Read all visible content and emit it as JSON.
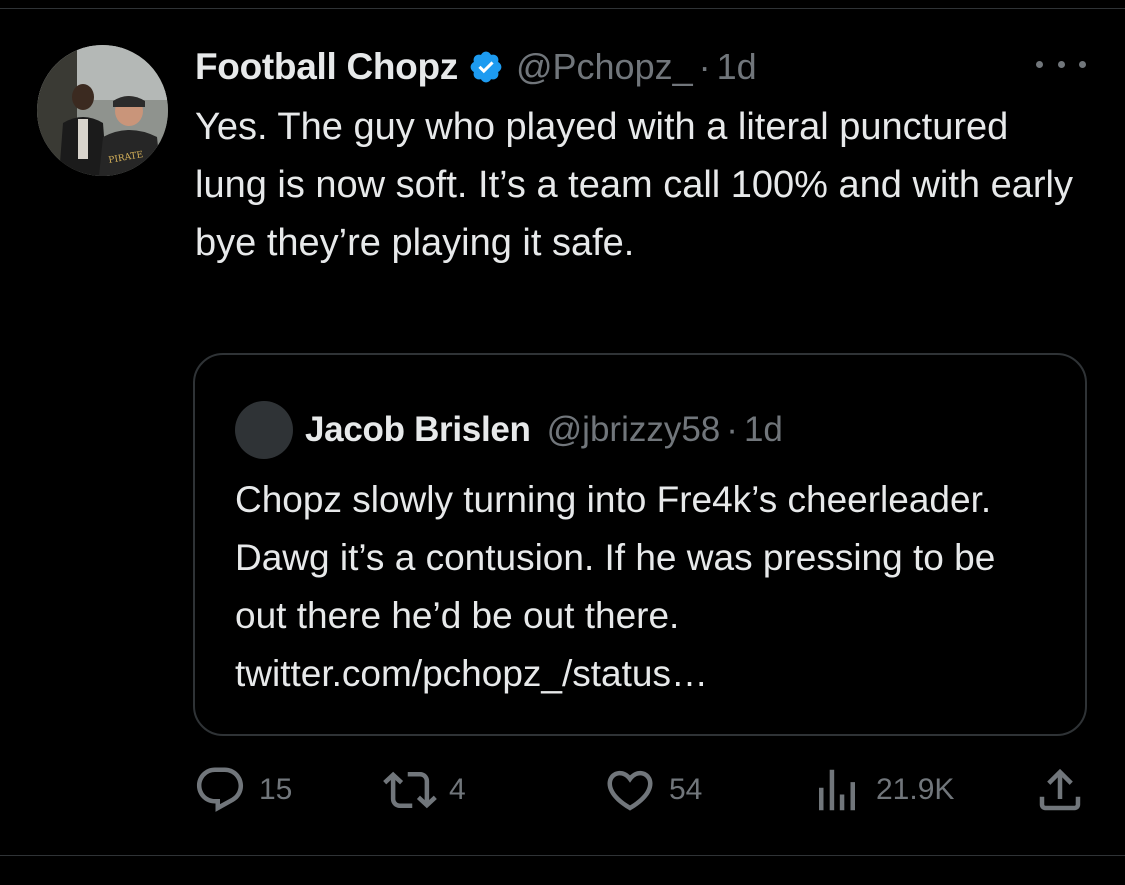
{
  "tweet": {
    "author_name": "Football Chopz",
    "author_handle": "@Pchopz_",
    "separator": "·",
    "time": "1d",
    "verified": true,
    "text": "Yes. The guy who played with a literal punctured lung is now soft. It’s a team call 100% and with early bye they’re playing it safe."
  },
  "quoted_tweet": {
    "author_name": "Jacob Brislen",
    "author_handle": "@jbrizzy58",
    "separator": "·",
    "time": "1d",
    "text": "Chopz slowly turning into Fre4k’s cheerleader. Dawg it’s a contusion. If he was pressing to be out there he’d be out there. twitter.com/pchopz_/status…"
  },
  "actions": {
    "replies": "15",
    "reposts": "4",
    "likes": "54",
    "views": "21.9K"
  },
  "icons": {
    "verified": "verified-badge-icon",
    "more": "more-icon",
    "reply": "reply-icon",
    "repost": "repost-icon",
    "like": "heart-icon",
    "views": "views-chart-icon",
    "share": "share-icon"
  },
  "colors": {
    "background": "#000000",
    "text": "#e7e9ea",
    "muted": "#71767b",
    "border": "#2f3336",
    "verified": "#1d9bf0"
  }
}
